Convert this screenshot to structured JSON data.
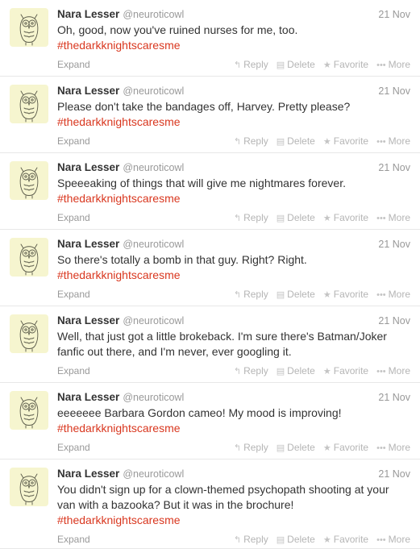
{
  "tweets": [
    {
      "name": "Nara Lesser",
      "handle": "@neuroticowl",
      "time": "21 Nov",
      "lines": [
        "Oh, good, now you've ruined nurses for me, too."
      ],
      "hashtag": "#thedarkknightscaresme"
    },
    {
      "name": "Nara Lesser",
      "handle": "@neuroticowl",
      "time": "21 Nov",
      "lines": [
        "Please don't take the bandages off, Harvey.  Pretty please?"
      ],
      "hashtag": "#thedarkknightscaresme"
    },
    {
      "name": "Nara Lesser",
      "handle": "@neuroticowl",
      "time": "21 Nov",
      "lines": [
        "Speeeaking of things that will give me nightmares forever.",
        "#thedarkknightscaresme"
      ],
      "hashtag": ""
    },
    {
      "name": "Nara Lesser",
      "handle": "@neuroticowl",
      "time": "21 Nov",
      "lines": [
        "So there's totally a bomb in that guy.  Right?  Right."
      ],
      "hashtag": "#thedarkknightscaresme"
    },
    {
      "name": "Nara Lesser",
      "handle": "@neuroticowl",
      "time": "21 Nov",
      "lines": [
        "Well, that just got a little brokeback.  I'm sure there's Batman/Joker",
        "fanfic out there, and I'm never, ever googling it."
      ],
      "hashtag": ""
    },
    {
      "name": "Nara Lesser",
      "handle": "@neuroticowl",
      "time": "21 Nov",
      "lines": [
        "eeeeeee Barbara Gordon cameo!  My mood is improving!"
      ],
      "hashtag": "#thedarkknightscaresme"
    },
    {
      "name": "Nara Lesser",
      "handle": "@neuroticowl",
      "time": "21 Nov",
      "lines": [
        "You didn't sign up for a clown-themed psychopath shooting at your",
        "van with a bazooka?  But it was in the brochure!"
      ],
      "hashtag": "#thedarkknightscaresme"
    }
  ],
  "actions": {
    "expand": "Expand",
    "reply": "Reply",
    "delete": "Delete",
    "favorite": "Favorite",
    "more": "More"
  },
  "icons": {
    "avatar": "owl-sketch-icon",
    "reply": "reply-arrow-icon",
    "delete": "trash-icon",
    "favorite": "star-icon",
    "more": "ellipsis-icon"
  },
  "colors": {
    "hashtag": "#d9371f",
    "avatar_bg": "#f6f5cf",
    "muted": "#999999"
  }
}
